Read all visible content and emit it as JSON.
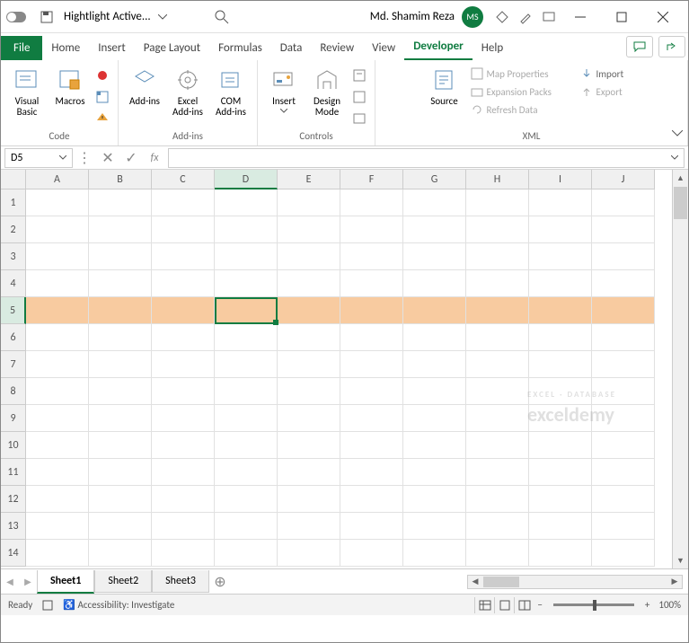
{
  "titlebar": {
    "doc_name": "Hightlight Active...",
    "user_name": "Md. Shamim Reza",
    "user_initials": "MS"
  },
  "tabs": {
    "file": "File",
    "items": [
      "Home",
      "Insert",
      "Page Layout",
      "Formulas",
      "Data",
      "Review",
      "View",
      "Developer",
      "Help"
    ],
    "active": "Developer"
  },
  "ribbon": {
    "code": {
      "label": "Code",
      "visual_basic": "Visual Basic",
      "macros": "Macros"
    },
    "addins": {
      "label": "Add-ins",
      "addins": "Add-ins",
      "excel_addins": "Excel Add-ins",
      "com_addins": "COM Add-ins"
    },
    "controls": {
      "label": "Controls",
      "insert": "Insert",
      "design_mode": "Design Mode"
    },
    "xml": {
      "label": "XML",
      "source": "Source",
      "map_properties": "Map Properties",
      "expansion_packs": "Expansion Packs",
      "refresh_data": "Refresh Data",
      "import": "Import",
      "export": "Export"
    }
  },
  "formula_bar": {
    "name_box": "D5",
    "formula": ""
  },
  "grid": {
    "columns": [
      "A",
      "B",
      "C",
      "D",
      "E",
      "F",
      "G",
      "H",
      "I",
      "J"
    ],
    "rows": [
      1,
      2,
      3,
      4,
      5,
      6,
      7,
      8,
      9,
      10,
      11,
      12,
      13,
      14
    ],
    "highlighted_row": 5,
    "active_col": "D",
    "active_row": 5
  },
  "sheets": {
    "items": [
      "Sheet1",
      "Sheet2",
      "Sheet3"
    ],
    "active": "Sheet1"
  },
  "status": {
    "ready": "Ready",
    "accessibility": "Accessibility: Investigate",
    "zoom": "100%",
    "zoom_minus": "−",
    "zoom_plus": "+"
  },
  "watermark": {
    "brand": "exceldemy",
    "tagline": "EXCEL · DATABASE"
  }
}
